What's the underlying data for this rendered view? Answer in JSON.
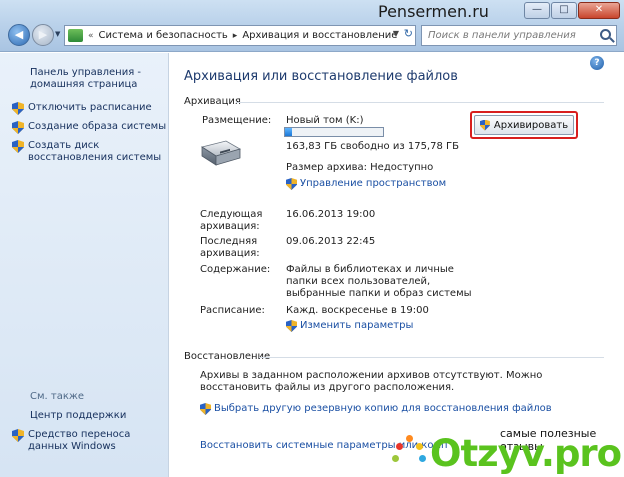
{
  "watermark": {
    "top_text": "Pensermen.ru",
    "bottom_caption": "самые полезные отзывы",
    "bottom_logo": "Otzyv.pro"
  },
  "window": {
    "minimize": "—",
    "maximize": "□",
    "close": "✕"
  },
  "address_bar": {
    "overflow": "«",
    "crumbs": [
      "Система и безопасность",
      "Архивация и восстановление"
    ],
    "separator": "▸"
  },
  "search": {
    "placeholder": "Поиск в панели управления"
  },
  "sidebar": {
    "home": "Панель управления - домашняя страница",
    "items": [
      {
        "label": "Отключить расписание"
      },
      {
        "label": "Создание образа системы"
      },
      {
        "label": "Создать диск восстановления системы"
      }
    ],
    "see_also": "См. также",
    "see_also_items": [
      {
        "label": "Центр поддержки"
      },
      {
        "label": "Средство переноса данных Windows"
      }
    ]
  },
  "main": {
    "title": "Архивация или восстановление файлов",
    "help": "?",
    "backup_section": "Архивация",
    "placement_label": "Размещение:",
    "volume_name": "Новый том (K:)",
    "disk_usage_fraction": 0.07,
    "free_space": "163,83 ГБ свободно из 175,78 ГБ",
    "archive_size": "Размер архива: Недоступно",
    "manage_space": "Управление пространством",
    "backup_button": "Архивировать",
    "next_label": "Следующая архивация:",
    "next_value": "16.06.2013 19:00",
    "last_label": "Последняя архивация:",
    "last_value": "09.06.2013 22:45",
    "content_label": "Содержание:",
    "content_value": "Файлы в библиотеках и личные папки всех пользователей, выбранные папки и образ системы",
    "schedule_label": "Расписание:",
    "schedule_value": "Кажд. воскресенье в 19:00",
    "change_settings": "Изменить параметры",
    "restore_section": "Восстановление",
    "restore_text": "Архивы в заданном расположении архивов отсутствуют. Можно восстановить файлы из другого расположения.",
    "restore_link": "Выбрать другую резервную копию для восстановления файлов",
    "restore_system_link": "Восстановить системные параметры или комп"
  }
}
